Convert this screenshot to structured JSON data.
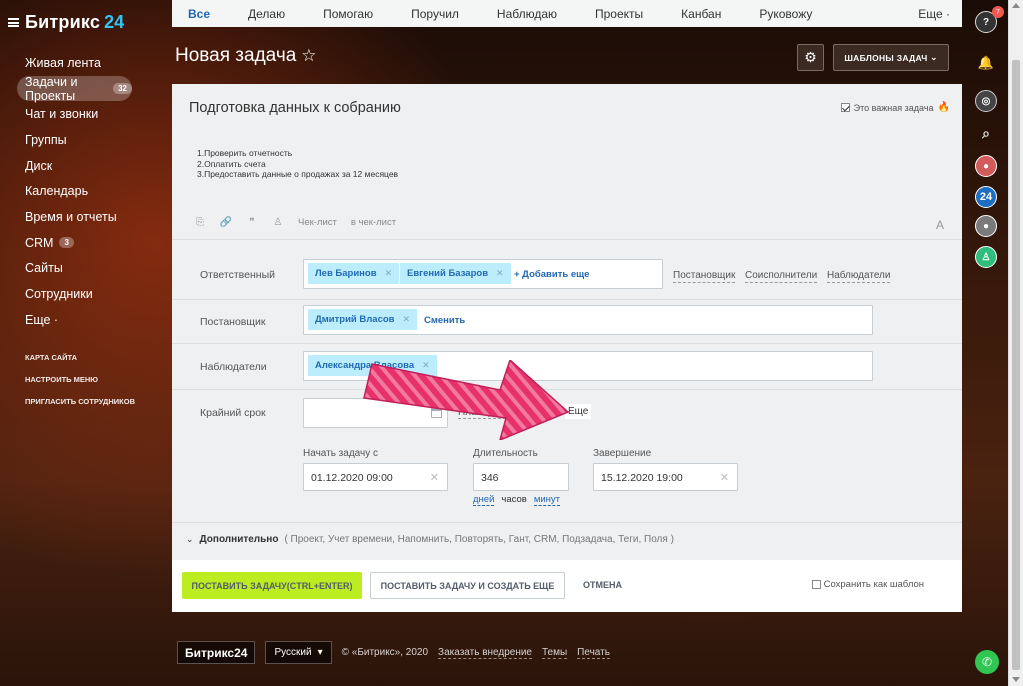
{
  "brand": {
    "name": "Битрикс",
    "num": "24"
  },
  "sidebar": {
    "items": [
      {
        "label": "Живая лента",
        "count": ""
      },
      {
        "label": "Задачи и Проекты",
        "count": "32"
      },
      {
        "label": "Чат и звонки",
        "count": ""
      },
      {
        "label": "Группы",
        "count": ""
      },
      {
        "label": "Диск",
        "count": ""
      },
      {
        "label": "Календарь",
        "count": ""
      },
      {
        "label": "Время и отчеты",
        "count": ""
      },
      {
        "label": "CRM",
        "count": "3"
      },
      {
        "label": "Сайты",
        "count": ""
      },
      {
        "label": "Сотрудники",
        "count": ""
      },
      {
        "label": "Еще ·",
        "count": ""
      }
    ],
    "links": [
      "Карта сайта",
      "Настроить меню",
      "Пригласить сотрудников"
    ]
  },
  "tabs": {
    "items": [
      "Все",
      "Делаю",
      "Помогаю",
      "Поручил",
      "Наблюдаю",
      "Проекты",
      "Канбан",
      "Руковожу"
    ],
    "more": "Еще ·"
  },
  "header": {
    "title": "Новая задача",
    "templates_label": "ШАБЛОНЫ ЗАДАЧ"
  },
  "task": {
    "title": "Подготовка данных к собранию",
    "important_label": "Это важная задача",
    "important_checked": true,
    "description": [
      "1.Проверить отчетность",
      "2.Оплатить счета",
      "3.Предоставить данные о продажах за 12 месяцев"
    ],
    "toolbar": {
      "checklist": "Чек-лист",
      "to_checklist": "в чек-лист"
    }
  },
  "fields": {
    "responsible": {
      "label": "Ответственный",
      "chips": [
        "Лев Баринов",
        "Евгений Базаров"
      ],
      "add": "+ Добавить еще"
    },
    "role_links": [
      "Постановщик",
      "Соисполнители",
      "Наблюдатели"
    ],
    "creator": {
      "label": "Постановщик",
      "chips": [
        "Дмитрий Власов"
      ],
      "change": "Сменить"
    },
    "observers": {
      "label": "Наблюдатели",
      "chips": [
        "Александра Власова"
      ]
    },
    "deadline": {
      "label": "Крайний срок",
      "planning": "Планировани",
      "more": "Еще"
    },
    "start": {
      "label": "Начать задачу с",
      "value": "01.12.2020 09:00"
    },
    "duration": {
      "label": "Длительность",
      "value": "346",
      "units": [
        "дней",
        "часов",
        "минут"
      ],
      "selected_unit": "часов"
    },
    "end": {
      "label": "Завершение",
      "value": "15.12.2020 19:00"
    }
  },
  "extra": {
    "label": "Дополнительно",
    "options": "( Проект,  Учет времени,  Напомнить,  Повторять,  Гант,  CRM,  Подзадача,  Теги,  Поля )"
  },
  "footer_actions": {
    "submit": "ПОСТАВИТЬ ЗАДАЧУ(CTRL+ENTER)",
    "submit_more": "ПОСТАВИТЬ ЗАДАЧУ И СОЗДАТЬ ЕЩЕ",
    "cancel": "ОТМЕНА",
    "save_template": "Сохранить как шаблон"
  },
  "right_panel": {
    "help_badge": "7",
    "b24": "24"
  },
  "page_footer": {
    "logo": "Битрикс24",
    "lang": "Русский",
    "copyright": "© «Битрикс», 2020",
    "order": "Заказать внедрение",
    "themes": "Темы",
    "print": "Печать"
  },
  "colors": {
    "accent": "#2067b0",
    "chip_bg": "#bcedfc",
    "submit_bg": "#bbed21",
    "arrow": "#e8306a"
  }
}
